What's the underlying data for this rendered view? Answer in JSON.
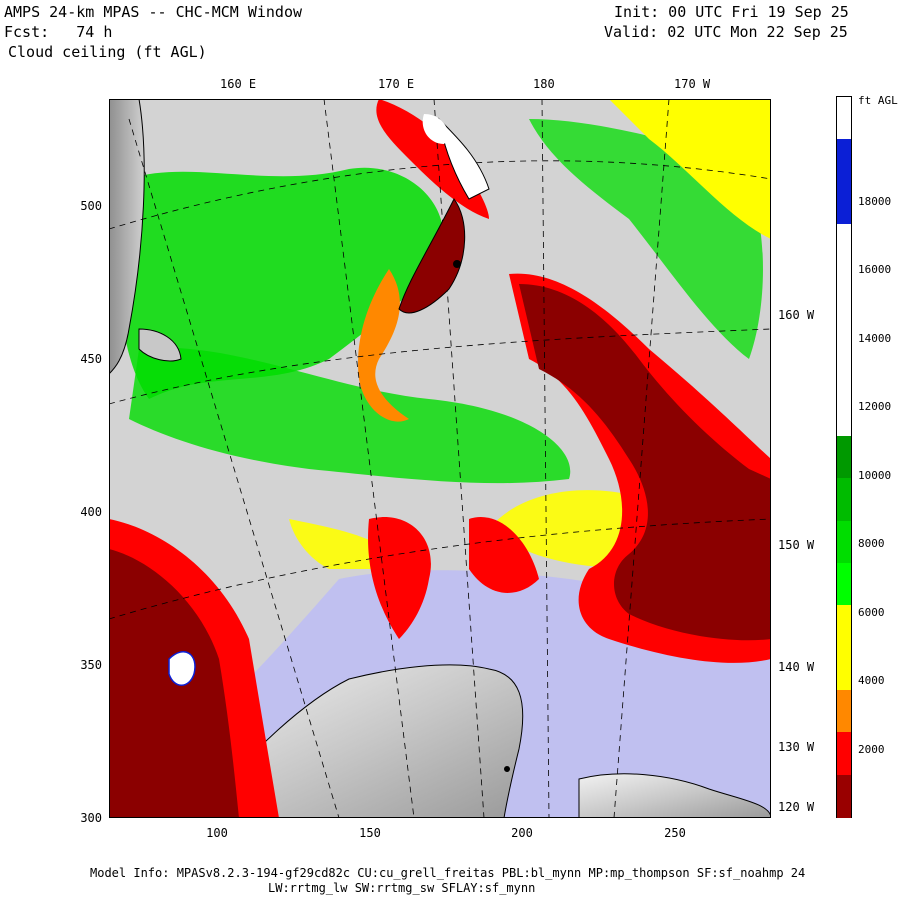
{
  "header": {
    "title_line1": "AMPS 24-km MPAS -- CHC-MCM Window",
    "title_line2": "Fcst:   74 h",
    "title_line3": "Cloud ceiling (ft AGL)",
    "init": "Init: 00 UTC Fri 19 Sep 25",
    "valid": "Valid: 02 UTC Mon 22 Sep 25"
  },
  "axes": {
    "y_ticks": [
      "500",
      "450",
      "400",
      "350",
      "300"
    ],
    "x_ticks": [
      "100",
      "150",
      "200",
      "250"
    ],
    "top_lon": [
      "160 E",
      "170 E",
      "180",
      "170 W"
    ],
    "right_lon": [
      "160 W",
      "150 W",
      "140 W",
      "130 W",
      "120 W"
    ]
  },
  "colorbar": {
    "unit": "ft AGL",
    "labels": [
      "18000",
      "16000",
      "14000",
      "12000",
      "10000",
      "8000",
      "6000",
      "4000",
      "2000"
    ],
    "colors": [
      "#ffffff",
      "#0b1fd6",
      "#0b1fd6",
      "#ffffff",
      "#ffffff",
      "#ffffff",
      "#ffffff",
      "#ffffff",
      "#009900",
      "#00bb00",
      "#00dd00",
      "#00ff00",
      "#ffff00",
      "#ffff00",
      "#ff8800",
      "#ff0000",
      "#990000"
    ]
  },
  "footer": {
    "line1": "Model Info: MPASv8.2.3-194-gf29cd82c CU:cu_grell_freitas PBL:bl_mynn MP:mp_thompson SF:sf_noahmp 24",
    "line2": "LW:rrtmg_lw SW:rrtmg_sw SFLAY:sf_mynn"
  },
  "colors": {
    "ocean_gray": "#d3d3d3",
    "sea_ice": "#c0c0f0",
    "dark_red": "#8b0000",
    "red": "#ff0000",
    "orange": "#ff8800",
    "yellow": "#ffff00",
    "green": "#00dd00"
  }
}
